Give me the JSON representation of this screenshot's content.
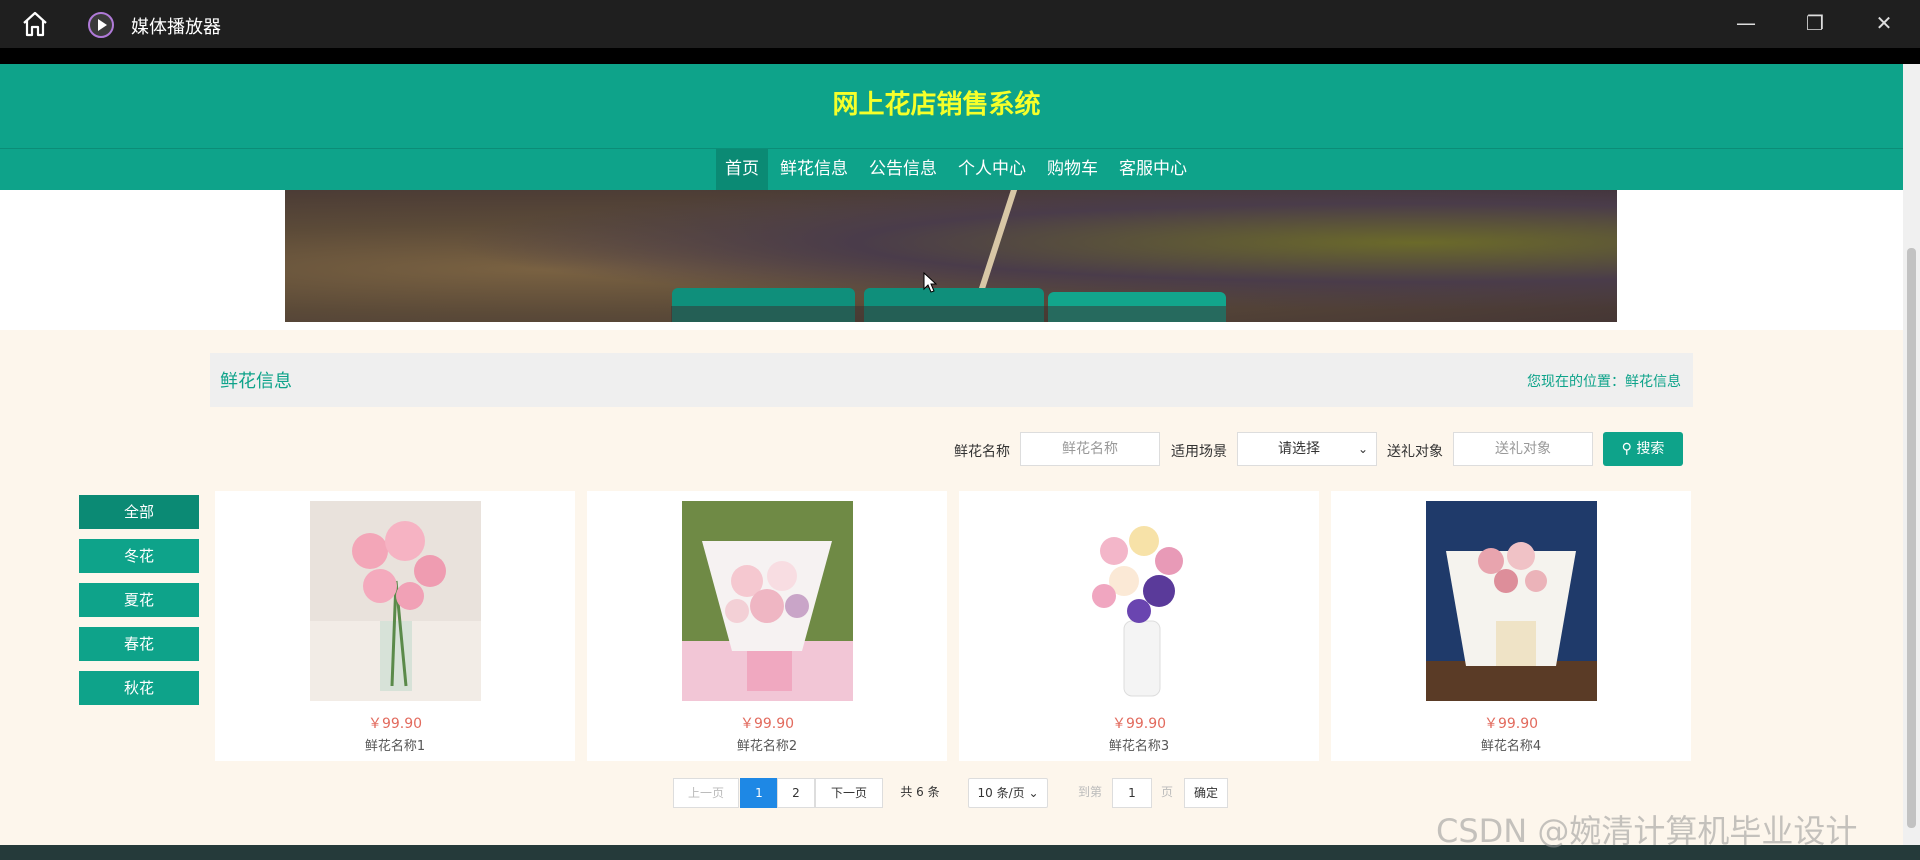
{
  "window": {
    "title": "媒体播放器",
    "controls": {
      "minimize": "—",
      "maximize": "❐",
      "close": "✕"
    }
  },
  "site": {
    "title": "网上花店销售系统",
    "nav": [
      "首页",
      "鲜花信息",
      "公告信息",
      "个人中心",
      "购物车",
      "客服中心"
    ],
    "active_nav": "首页"
  },
  "section": {
    "title": "鲜花信息",
    "location_label": "您现在的位置：",
    "location_value": "鲜花信息"
  },
  "search": {
    "name_label": "鲜花名称",
    "name_placeholder": "鲜花名称",
    "scene_label": "适用场景",
    "scene_value": "请选择",
    "target_label": "送礼对象",
    "target_placeholder": "送礼对象",
    "button_label": "搜索"
  },
  "categories": [
    "全部",
    "冬花",
    "夏花",
    "春花",
    "秋花"
  ],
  "products": [
    {
      "price": "￥99.90",
      "name": "鲜花名称1",
      "image": "pink ranunculus in glass vase"
    },
    {
      "price": "￥99.90",
      "name": "鲜花名称2",
      "image": "pink rose bouquet"
    },
    {
      "price": "￥99.90",
      "name": "鲜花名称3",
      "image": "mixed flowers in white vase"
    },
    {
      "price": "￥99.90",
      "name": "鲜花名称4",
      "image": "white wrapped bouquet"
    }
  ],
  "pagination": {
    "prev": "上一页",
    "pages": [
      "1",
      "2"
    ],
    "current": "1",
    "next": "下一页",
    "total": "共 6 条",
    "page_size": "10 条/页",
    "goto_label": "到第",
    "goto_value": "1",
    "page_unit": "页",
    "confirm": "确定"
  },
  "watermark": "CSDN @婉清计算机毕业设计"
}
